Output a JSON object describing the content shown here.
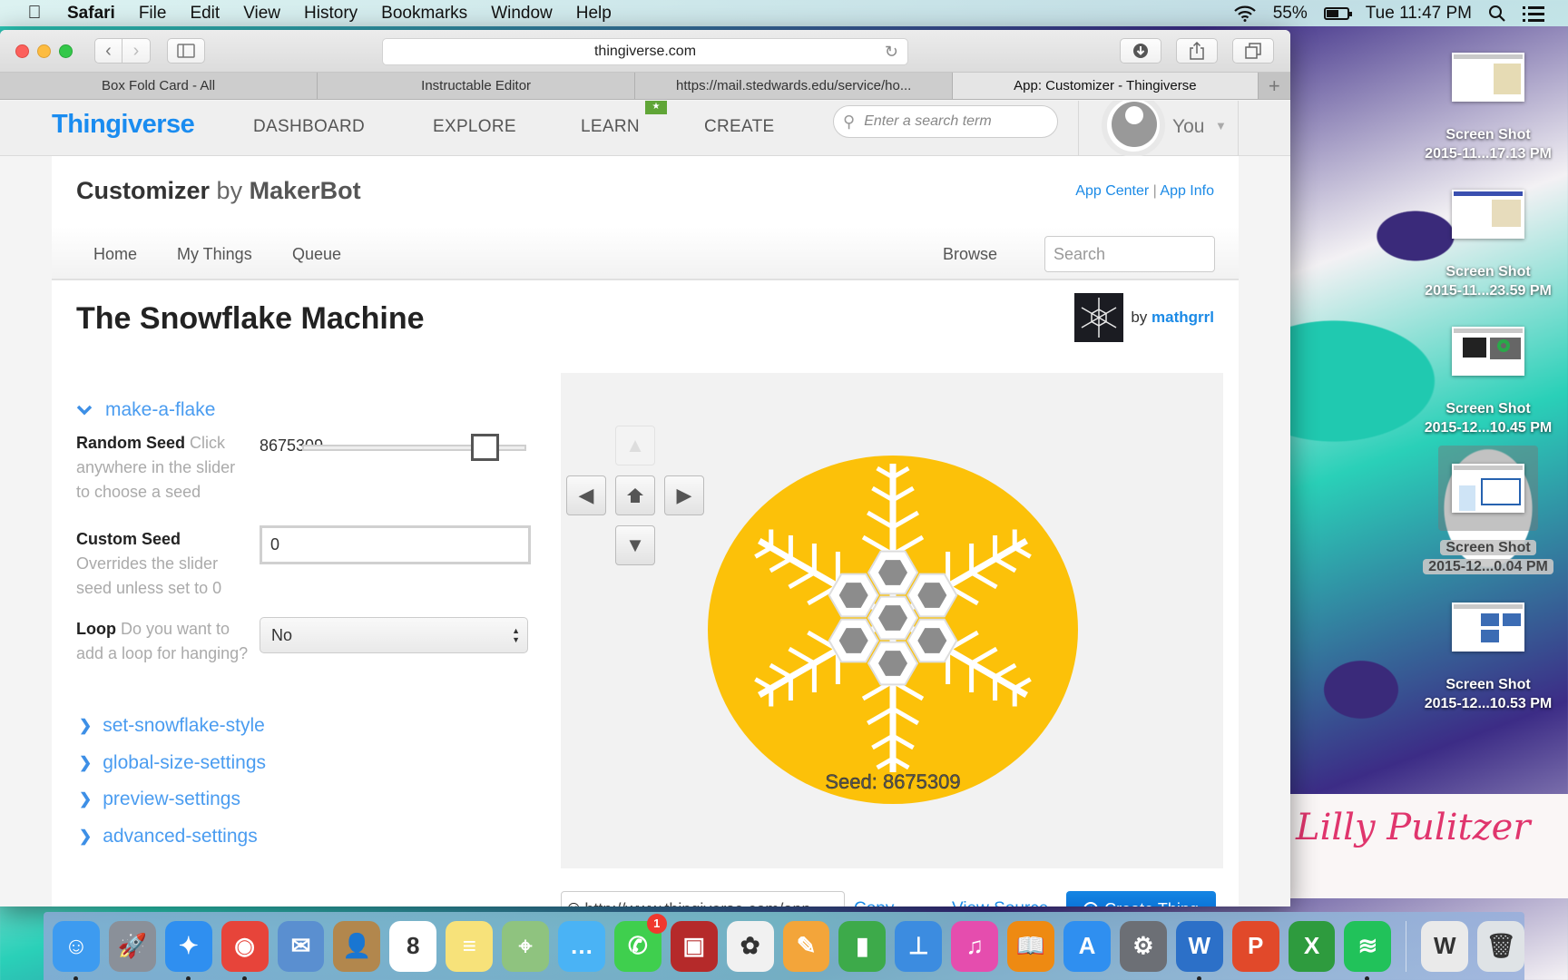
{
  "menubar": {
    "app_name": "Safari",
    "items": [
      "File",
      "Edit",
      "View",
      "History",
      "Bookmarks",
      "Window",
      "Help"
    ],
    "battery": "55%",
    "clock": "Tue 11:47 PM"
  },
  "browser": {
    "url": "thingiverse.com",
    "tabs": [
      {
        "title": "Box Fold Card - All",
        "active": false
      },
      {
        "title": "Instructable Editor",
        "active": false
      },
      {
        "title": "https://mail.stedwards.edu/service/ho...",
        "active": false
      },
      {
        "title": "App: Customizer - Thingiverse",
        "active": true
      }
    ]
  },
  "site": {
    "logo": "Thingiverse",
    "nav": [
      "DASHBOARD",
      "EXPLORE",
      "LEARN",
      "CREATE"
    ],
    "learn_badge": "★",
    "search_placeholder": "Enter a search term",
    "user_label": "You"
  },
  "app": {
    "title": "Customizer",
    "by": "by",
    "maker": "MakerBot",
    "links": {
      "app_center": "App Center",
      "separator": "|",
      "app_info": "App Info"
    },
    "subnav": {
      "home": "Home",
      "my_things": "My Things",
      "queue": "Queue",
      "browse": "Browse",
      "search_placeholder": "Search"
    }
  },
  "thing": {
    "title": "The Snowflake Machine",
    "by": "by",
    "author": "mathgrrl"
  },
  "params": {
    "open_group": "make-a-flake",
    "random_seed": {
      "label": "Random Seed",
      "help": "Click anywhere in the slider to choose a seed",
      "value": "8675309",
      "slider_fraction": 0.86
    },
    "custom_seed": {
      "label": "Custom Seed",
      "help": "Overrides the slider seed unless set to 0",
      "value": "0"
    },
    "loop": {
      "label": "Loop",
      "help": "Do you want to add a loop for hanging?",
      "selected": "No"
    },
    "closed_groups": [
      "set-snowflake-style",
      "global-size-settings",
      "preview-settings",
      "advanced-settings"
    ]
  },
  "preview": {
    "seed_caption": "Seed: 8675309",
    "disc_color": "#fcc109",
    "hex_color": "#8c8c8c"
  },
  "actions": {
    "share_url": "http://www.thingiverse.com/app",
    "copy": "Copy",
    "view_source": "View Source",
    "create": "Create Thing"
  },
  "desktop": {
    "icons": [
      {
        "line1": "Screen Shot",
        "line2": "2015-11...17.13 PM",
        "selected": false
      },
      {
        "line1": "Screen Shot",
        "line2": "2015-11...23.59 PM",
        "selected": false
      },
      {
        "line1": "Screen Shot",
        "line2": "2015-12...10.45 PM",
        "selected": false
      },
      {
        "line1": "Screen Shot",
        "line2": "2015-12...0.04 PM",
        "selected": true
      },
      {
        "line1": "Screen Shot",
        "line2": "2015-12...10.53 PM",
        "selected": false
      }
    ],
    "wallpaper_signature": "Lilly Pulitzer"
  },
  "dock": {
    "apps": [
      {
        "name": "finder",
        "running": true,
        "color": "#3d9bf0",
        "glyph": "☺"
      },
      {
        "name": "launchpad",
        "running": false,
        "color": "#8a9099",
        "glyph": "🚀"
      },
      {
        "name": "safari",
        "running": true,
        "color": "#2f8ff0",
        "glyph": "✦"
      },
      {
        "name": "chrome",
        "running": true,
        "color": "#e7443a",
        "glyph": "◉"
      },
      {
        "name": "mail",
        "running": false,
        "color": "#5a8fd0",
        "glyph": "✉"
      },
      {
        "name": "contacts",
        "running": false,
        "color": "#b2874d",
        "glyph": "👤"
      },
      {
        "name": "calendar",
        "running": false,
        "color": "#ffffff",
        "glyph": "8"
      },
      {
        "name": "notes",
        "running": false,
        "color": "#f7e27a",
        "glyph": "≡"
      },
      {
        "name": "maps",
        "running": false,
        "color": "#8fc37f",
        "glyph": "⌖"
      },
      {
        "name": "messages",
        "running": false,
        "color": "#4ab3f5",
        "glyph": "…"
      },
      {
        "name": "facetime",
        "running": false,
        "color": "#3fcf4e",
        "glyph": "✆",
        "badge": "1"
      },
      {
        "name": "photo-booth",
        "running": false,
        "color": "#b52a2a",
        "glyph": "▣"
      },
      {
        "name": "photos",
        "running": false,
        "color": "#f1f1f1",
        "glyph": "✿"
      },
      {
        "name": "pages",
        "running": false,
        "color": "#f3a53a",
        "glyph": "✎"
      },
      {
        "name": "numbers",
        "running": false,
        "color": "#3daa4a",
        "glyph": "▮"
      },
      {
        "name": "keynote",
        "running": false,
        "color": "#3c8ce0",
        "glyph": "⊥"
      },
      {
        "name": "itunes",
        "running": false,
        "color": "#e54dae",
        "glyph": "♫"
      },
      {
        "name": "ibooks",
        "running": false,
        "color": "#ee8a12",
        "glyph": "📖"
      },
      {
        "name": "app-store",
        "running": false,
        "color": "#2f8ff0",
        "glyph": "A"
      },
      {
        "name": "system-preferences",
        "running": false,
        "color": "#6c6f75",
        "glyph": "⚙"
      },
      {
        "name": "word",
        "running": true,
        "color": "#2c70c8",
        "glyph": "W"
      },
      {
        "name": "powerpoint",
        "running": false,
        "color": "#e1492a",
        "glyph": "P"
      },
      {
        "name": "excel",
        "running": false,
        "color": "#2e9b3e",
        "glyph": "X"
      },
      {
        "name": "spotify",
        "running": true,
        "color": "#21c25a",
        "glyph": "≋"
      }
    ],
    "docs": [
      {
        "name": "word-document",
        "color": "#eaeaea",
        "glyph": "W"
      },
      {
        "name": "trash",
        "color": "#dfe3e6",
        "glyph": "🗑"
      }
    ]
  }
}
